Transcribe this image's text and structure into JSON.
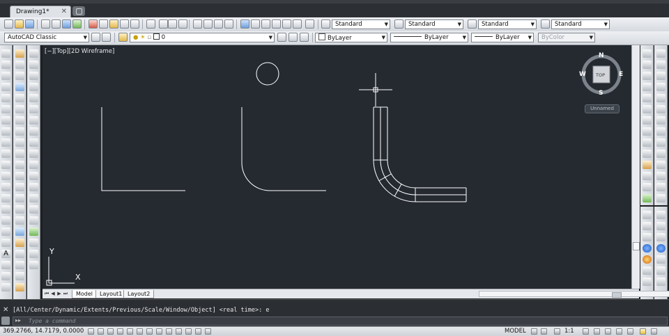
{
  "document_tab": {
    "title": "Drawing1*",
    "close": "✕"
  },
  "toolbar1": {
    "dropdowns": [
      "Standard",
      "Standard",
      "Standard",
      "Standard"
    ]
  },
  "toolbar2": {
    "workspace": "AutoCAD Classic",
    "layer": "0",
    "color": "ByLayer",
    "linetype": "ByLayer",
    "lineweight": "ByLayer",
    "plotstyle": "ByColor"
  },
  "viewport": {
    "label": "[−][Top][2D Wireframe]",
    "ucs": {
      "x": "X",
      "y": "Y"
    }
  },
  "viewcube": {
    "top_face": "TOP",
    "north": "N",
    "south": "S",
    "east": "E",
    "west": "W",
    "ucs_menu": "Unnamed"
  },
  "layout_tabs": {
    "nav": [
      "⏮",
      "◀",
      "▶",
      "⏭"
    ],
    "tabs": [
      "Model",
      "Layout1",
      "Layout2"
    ],
    "active": "Model"
  },
  "command": {
    "history": "[All/Center/Dynamic/Extents/Previous/Scale/Window/Object] <real time>: e",
    "prompt_icon": "▸▸",
    "placeholder": "Type a command",
    "close": "✕"
  },
  "status": {
    "coords": "369.2766, 14.7179, 0.0000",
    "model": "MODEL",
    "scale": "1:1"
  },
  "colors": {
    "canvas": "#252a31",
    "toolbar": "#e2e5e9",
    "command_bg": "#2b2e33",
    "geometry": "#ffffff"
  }
}
